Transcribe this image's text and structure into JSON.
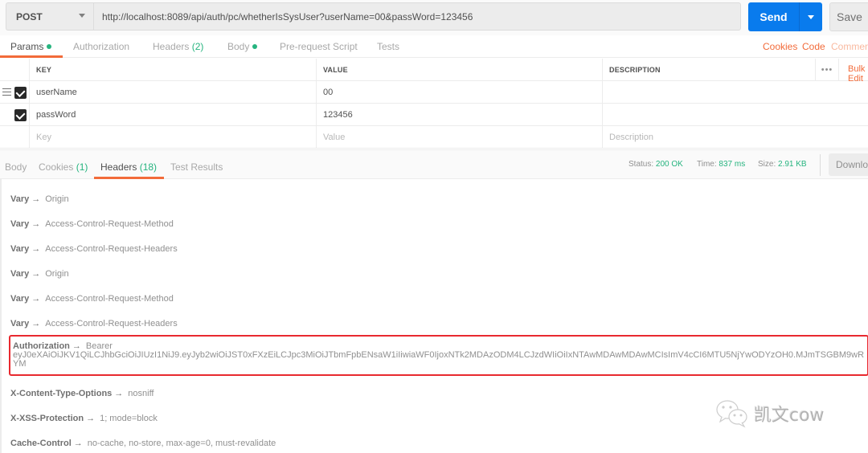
{
  "request": {
    "method": "POST",
    "url": "http://localhost:8089/api/auth/pc/whetherIsSysUser?userName=00&passWord=123456",
    "send_label": "Send",
    "save_label": "Save"
  },
  "request_tabs": [
    {
      "label": "Params",
      "has_dot": true,
      "active": true
    },
    {
      "label": "Authorization"
    },
    {
      "label": "Headers",
      "count": "(2)"
    },
    {
      "label": "Body",
      "has_dot": true
    },
    {
      "label": "Pre-request Script"
    },
    {
      "label": "Tests"
    }
  ],
  "request_links": {
    "cookies": "Cookies",
    "code": "Code",
    "comments": "Comments"
  },
  "params": {
    "columns": {
      "key": "KEY",
      "value": "VALUE",
      "description": "DESCRIPTION"
    },
    "bulk_edit": "Bulk Edit",
    "more": "•••",
    "rows": [
      {
        "checked": true,
        "key": "userName",
        "value": "00",
        "description": ""
      },
      {
        "checked": true,
        "key": "passWord",
        "value": "123456",
        "description": ""
      }
    ],
    "placeholders": {
      "key": "Key",
      "value": "Value",
      "description": "Description"
    }
  },
  "response_tabs": [
    {
      "label": "Body"
    },
    {
      "label": "Cookies",
      "count": "(1)"
    },
    {
      "label": "Headers",
      "count": "(18)",
      "active": true
    },
    {
      "label": "Test Results"
    }
  ],
  "response_status": {
    "status_label": "Status:",
    "status": "200 OK",
    "time_label": "Time:",
    "time": "837 ms",
    "size_label": "Size:",
    "size": "2.91 KB",
    "download_label": "Download"
  },
  "response_headers": [
    {
      "key": "Vary",
      "value": "Origin"
    },
    {
      "key": "Vary",
      "value": "Access-Control-Request-Method"
    },
    {
      "key": "Vary",
      "value": "Access-Control-Request-Headers"
    },
    {
      "key": "Vary",
      "value": "Origin"
    },
    {
      "key": "Vary",
      "value": "Access-Control-Request-Method"
    },
    {
      "key": "Vary",
      "value": "Access-Control-Request-Headers"
    },
    {
      "key": "Authorization",
      "value": "Bearer",
      "token": "eyJ0eXAiOiJKV1QiLCJhbGciOiJIUzI1NiJ9.eyJyb2wiOiJST0xFXzEiLCJpc3MiOiJTbmFpbENsaW1iIiwiaWF0IjoxNTk2MDAzODM4LCJzdWIiOiIxNTAwMDAwMDAwMCIsImV4cCI6MTU5NjYwODYzOH0.MJmTSGBM9wRYM",
      "highlighted": true
    },
    {
      "key": "X-Content-Type-Options",
      "value": "nosniff"
    },
    {
      "key": "X-XSS-Protection",
      "value": "1; mode=block"
    },
    {
      "key": "Cache-Control",
      "value": "no-cache, no-store, max-age=0, must-revalidate"
    }
  ],
  "arrow": "→",
  "watermark": {
    "text": "凯文cow",
    "icon": "wechat-icon"
  },
  "colors": {
    "accent": "#f26b3a",
    "send": "#097bed",
    "success": "#26b47f",
    "highlight_border": "#e8292f"
  }
}
